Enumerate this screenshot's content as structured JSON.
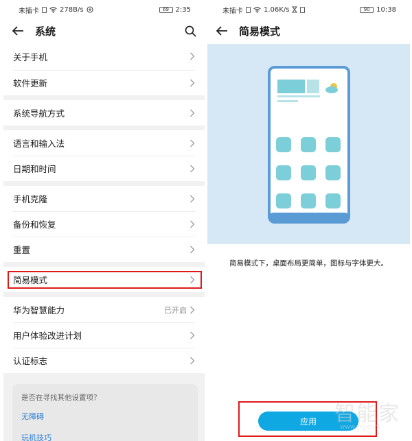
{
  "left": {
    "status": {
      "carrier": "未插卡",
      "speed": "278B/s",
      "battery": "69",
      "time": "2:35"
    },
    "title": "系统",
    "groups": [
      [
        {
          "label": "关于手机"
        },
        {
          "label": "软件更新"
        }
      ],
      [
        {
          "label": "系统导航方式"
        }
      ],
      [
        {
          "label": "语言和输入法"
        },
        {
          "label": "日期和时间"
        }
      ],
      [
        {
          "label": "手机克隆"
        },
        {
          "label": "备份和恢复"
        },
        {
          "label": "重置"
        }
      ],
      [
        {
          "label": "简易模式"
        }
      ],
      [
        {
          "label": "华为智慧能力",
          "value": "已开启"
        },
        {
          "label": "用户体验改进计划"
        },
        {
          "label": "认证标志"
        }
      ]
    ],
    "suggest": {
      "question": "是否在寻找其他设置项？",
      "links": [
        "无障碍",
        "玩机技巧"
      ]
    }
  },
  "right": {
    "status": {
      "carrier": "未插卡",
      "speed": "1.06K/s",
      "battery": "90",
      "time": "10:38"
    },
    "title": "简易模式",
    "description": "简易模式下，桌面布局更简单，图标与字体更大。",
    "apply_label": "应用"
  },
  "watermark": {
    "big": "智能家",
    "small": "www.znj.com"
  },
  "colors": {
    "accent": "#0fa8e2",
    "highlight": "#e01818",
    "preview_bg": "#d6e8f6",
    "tile": "#7ccfd8",
    "phone_frame": "#5b9bd5"
  }
}
